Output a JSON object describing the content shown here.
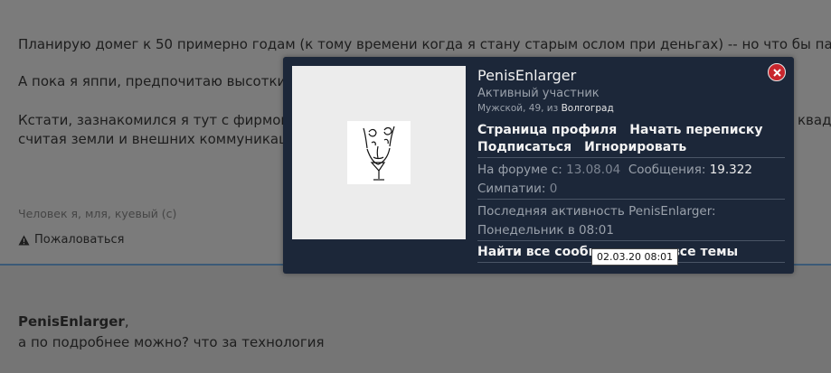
{
  "post": {
    "line1": "Планирую домег к 50 примерно годам (к тому времени когда я стану старым ослом при деньгах) -- но что бы пафо",
    "line2": "А пока я яппи, предпочитаю высотки.",
    "line3": "Кстати, зазнакомился я тут с фирмой,",
    "line3_tail": "квад",
    "line4": "считая земли и внешних коммуникаци",
    "signature": "Человек я, мля, куевый (с)",
    "report_label": "Пожаловаться"
  },
  "reply": {
    "author": "PenisEnlarger",
    "author_suffix": ",",
    "text": "а по подробнее можно? что за технология"
  },
  "popup": {
    "username": "PenisEnlarger",
    "user_title": "Активный участник",
    "meta_prefix": "Мужской, 49, из ",
    "city": "Волгоград",
    "profile_link": "Страница профиля",
    "conversation_link": "Начать переписку",
    "follow_link": "Подписаться",
    "ignore_link": "Игнорировать",
    "joined_label": "На форуме с: ",
    "joined_value": "13.08.04",
    "messages_label": "Сообщения: ",
    "messages_value": "19.322",
    "likes_label": "Симпатии: ",
    "likes_value": "0",
    "last_activity_label": "Последняя активность PenisEnlarger:",
    "last_activity_value": "Понедельник в 08:01",
    "find_content_link": "Найти все сообщения",
    "find_threads_link": "все темы"
  },
  "tooltip": {
    "text": "02.03.20 08:01"
  },
  "colors": {
    "overlay_bg": "#7b7b7b",
    "popup_bg": "#1c2739",
    "close_red": "#c8262d",
    "divider_blue": "#3b5a77"
  },
  "icons": {
    "report": "warning-triangle-icon",
    "close": "close-x-icon"
  }
}
